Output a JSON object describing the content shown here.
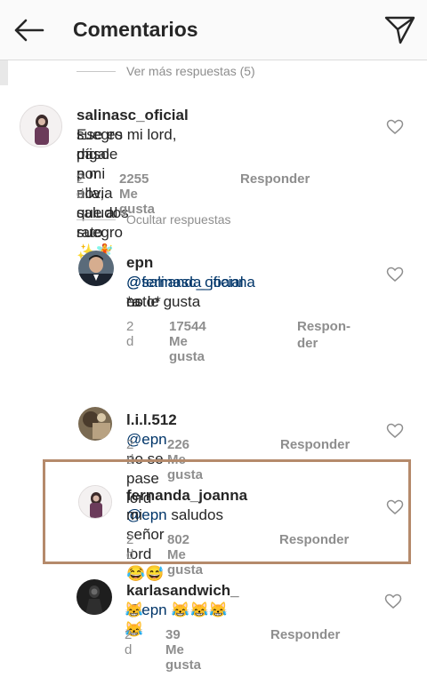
{
  "header": {
    "title": "Comentarios",
    "back_icon": "arrow-left-icon",
    "send_icon": "paper-plane-icon"
  },
  "more_replies": "Ver más respuestas (5)",
  "hide_replies": "Ocultar respuestas",
  "comments": [
    {
      "username": "salinasc_oficial",
      "text_l1": "Ese es mi lord, mi",
      "text_l2": "suegro dígale a mi novia que al rato",
      "text_l3": "paso por ella, saludos suegro ✨🧚",
      "time": "2 d",
      "likes": "2255 Me gusta",
      "reply": "Responder"
    },
    {
      "username": "epn",
      "mention": "@salinasc_oficial",
      "text_l1": "*a",
      "mention2": "@fernanda_joanna",
      "text_l2": "no le gusta",
      "text_l3": "esto*",
      "time": "2 d",
      "likes": "17544 Me gusta",
      "reply_l1": "Respon-",
      "reply_l2": "der"
    },
    {
      "username": "l.i.l.512",
      "mention": "@epn",
      "text": "no se pase lord",
      "time": "2 d",
      "likes": "226 Me gusta",
      "reply": "Responder"
    },
    {
      "username": "fernanda_joanna",
      "mention": "@epn",
      "text_l1": "saludos",
      "text_l2": "mi señor lord 😂😅",
      "time": "2 d",
      "likes": "802 Me gusta",
      "reply": "Responder"
    },
    {
      "username": "karlasandwich_",
      "mention": "@epn",
      "text_l1": "😹😹😹",
      "text_l2": "😹😹",
      "time": "2 d",
      "likes": "39 Me gusta",
      "reply": "Responder"
    }
  ],
  "colors": {
    "highlight": "#b58a6b",
    "mention": "#003569",
    "meta": "#8e8e8e"
  }
}
